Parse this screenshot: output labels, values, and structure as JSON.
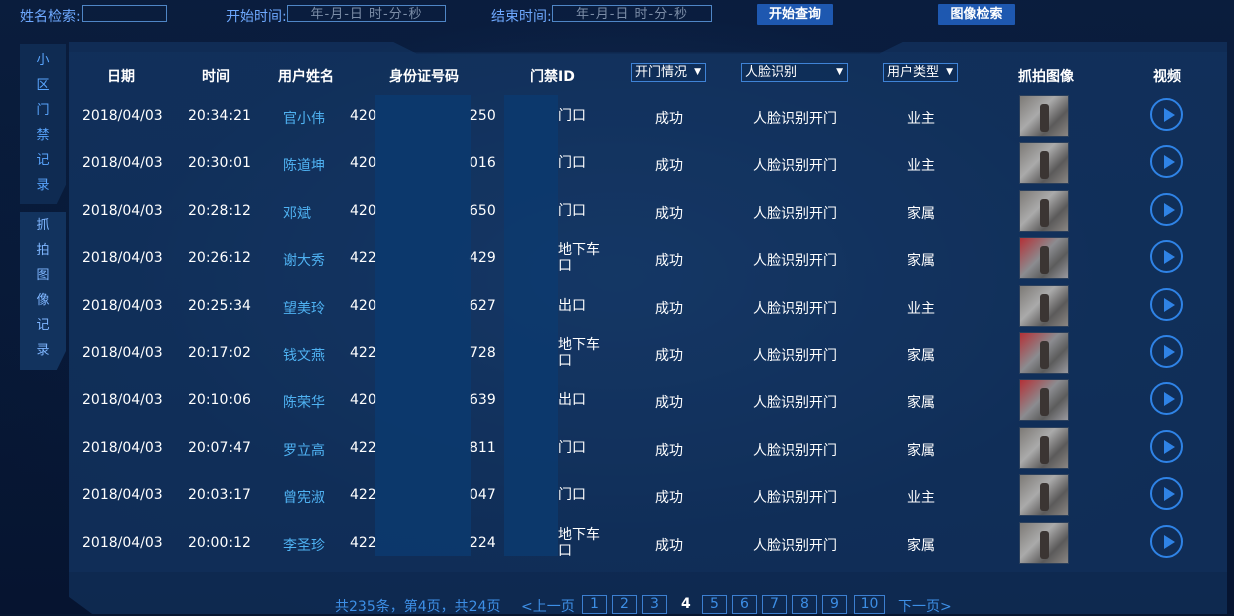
{
  "search": {
    "name_label": "姓名检索:",
    "name_value": "",
    "start_label": "开始时间:",
    "start_placeholder": "年-月-日 时-分-秒",
    "end_label": "结束时间:",
    "end_placeholder": "年-月-日 时-分-秒",
    "query_button": "开始查询",
    "image_search_button": "图像检索"
  },
  "sidebar": {
    "tab1": [
      "小",
      "区",
      "门",
      "禁",
      "记",
      "录"
    ],
    "tab2": [
      "抓",
      "拍",
      "图",
      "像",
      "记",
      "录"
    ]
  },
  "table": {
    "headers": {
      "date": "日期",
      "time": "时间",
      "name": "用户姓名",
      "id": "身份证号码",
      "door": "门禁ID",
      "open_status": "开门情况",
      "face": "人脸识别",
      "user_type": "用户类型",
      "photo": "抓拍图像",
      "video": "视频"
    },
    "rows": [
      {
        "date": "2018/04/03",
        "time": "20:34:21",
        "name": "官小伟",
        "id_prefix": "420",
        "id_suffix": "250",
        "door": "门口",
        "status": "成功",
        "method": "人脸识别开门",
        "type": "业主"
      },
      {
        "date": "2018/04/03",
        "time": "20:30:01",
        "name": "陈道坤",
        "id_prefix": "420",
        "id_suffix": "016",
        "door": "门口",
        "status": "成功",
        "method": "人脸识别开门",
        "type": "业主"
      },
      {
        "date": "2018/04/03",
        "time": "20:28:12",
        "name": "邓斌",
        "id_prefix": "420",
        "id_suffix": "650",
        "door": "门口",
        "status": "成功",
        "method": "人脸识别开门",
        "type": "家属"
      },
      {
        "date": "2018/04/03",
        "time": "20:26:12",
        "name": "谢大秀",
        "id_prefix": "422",
        "id_suffix": "429",
        "door": "地下车\n口",
        "status": "成功",
        "method": "人脸识别开门",
        "type": "家属"
      },
      {
        "date": "2018/04/03",
        "time": "20:25:34",
        "name": "望美玲",
        "id_prefix": "420",
        "id_suffix": "627",
        "door": "出口",
        "status": "成功",
        "method": "人脸识别开门",
        "type": "业主"
      },
      {
        "date": "2018/04/03",
        "time": "20:17:02",
        "name": "钱文燕",
        "id_prefix": "422",
        "id_suffix": "728",
        "door": "地下车\n口",
        "status": "成功",
        "method": "人脸识别开门",
        "type": "家属"
      },
      {
        "date": "2018/04/03",
        "time": "20:10:06",
        "name": "陈荣华",
        "id_prefix": "420",
        "id_suffix": "639",
        "door": "出口",
        "status": "成功",
        "method": "人脸识别开门",
        "type": "家属"
      },
      {
        "date": "2018/04/03",
        "time": "20:07:47",
        "name": "罗立高",
        "id_prefix": "422",
        "id_suffix": "811",
        "door": "门口",
        "status": "成功",
        "method": "人脸识别开门",
        "type": "家属"
      },
      {
        "date": "2018/04/03",
        "time": "20:03:17",
        "name": "曾宪淑",
        "id_prefix": "422",
        "id_suffix": "047",
        "door": "门口",
        "status": "成功",
        "method": "人脸识别开门",
        "type": "业主"
      },
      {
        "date": "2018/04/03",
        "time": "20:00:12",
        "name": "李圣珍",
        "id_prefix": "422",
        "id_suffix": "224",
        "door": "地下车\n口",
        "status": "成功",
        "method": "人脸识别开门",
        "type": "家属"
      }
    ]
  },
  "pagination": {
    "summary": "共235条，第4页，共24页",
    "prev": "<上一页",
    "pages": [
      "1",
      "2",
      "3",
      "4",
      "5",
      "6",
      "7",
      "8",
      "9",
      "10"
    ],
    "current": "4",
    "next": "下一页>"
  },
  "colors": {
    "accent": "#1e58b0",
    "link": "#4fb2f2",
    "play": "#2f83e6"
  }
}
